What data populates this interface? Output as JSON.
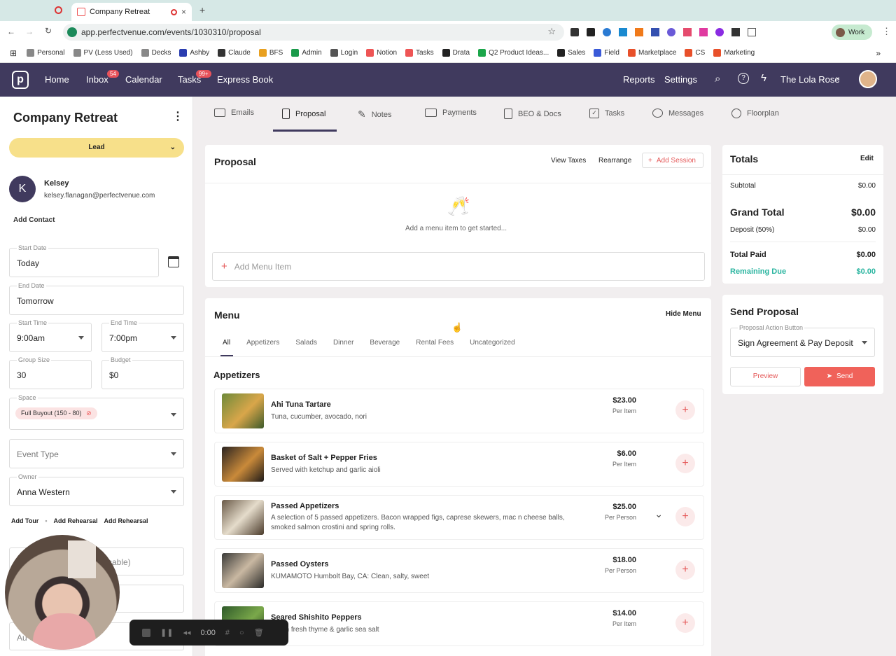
{
  "browser": {
    "tab_title": "Company Retreat",
    "url": "app.perfectvenue.com/events/1030310/proposal",
    "profile": "Work",
    "bookmarks": [
      "Personal",
      "PV (Less Used)",
      "Decks",
      "Ashby",
      "Claude",
      "BFS",
      "Admin",
      "Login",
      "Notion",
      "Tasks",
      "Drata",
      "Q2 Product Ideas...",
      "Sales",
      "Field",
      "Marketplace",
      "CS",
      "Marketing"
    ]
  },
  "nav": {
    "items": [
      "Home",
      "Inbox",
      "Calendar",
      "Tasks",
      "Express Book"
    ],
    "inbox_badge": "54",
    "tasks_badge": "99+",
    "reports": "Reports",
    "settings": "Settings",
    "venue": "The Lola Rose"
  },
  "sidebar": {
    "title": "Company Retreat",
    "status": "Lead",
    "contact_initial": "K",
    "contact_name": "Kelsey",
    "contact_email": "kelsey.flanagan@perfectvenue.com",
    "add_contact": "Add Contact",
    "start_date_label": "Start Date",
    "start_date": "Today",
    "end_date_label": "End Date",
    "end_date": "Tomorrow",
    "start_time_label": "Start Time",
    "start_time": "9:00am",
    "end_time_label": "End Time",
    "end_time": "7:00pm",
    "group_size_label": "Group Size",
    "group_size": "30",
    "budget_label": "Budget",
    "budget": "$0",
    "space_label": "Space",
    "space_chip": "Full Buyout (150 - 80)",
    "event_type_placeholder": "Event Type",
    "owner_label": "Owner",
    "owner": "Anna Western",
    "add_tour": "Add Tour",
    "add_rehearsal_1": "Add Rehearsal",
    "add_rehearsal_2": "Add Rehearsal",
    "partial_field_1": "cable)",
    "partial_field_3": "Au"
  },
  "tabs": [
    "Emails",
    "Proposal",
    "Notes",
    "Payments",
    "BEO & Docs",
    "Tasks",
    "Messages",
    "Floorplan"
  ],
  "proposal": {
    "title": "Proposal",
    "view_taxes": "View Taxes",
    "rearrange": "Rearrange",
    "add_session": "Add Session",
    "empty_text": "Add a menu item to get started...",
    "add_menu_item": "Add Menu Item"
  },
  "menu": {
    "title": "Menu",
    "hide": "Hide Menu",
    "filters": [
      "All",
      "Appetizers",
      "Salads",
      "Dinner",
      "Beverage",
      "Rental Fees",
      "Uncategorized"
    ],
    "section": "Appetizers",
    "items": [
      {
        "name": "Ahi Tuna Tartare",
        "desc": "Tuna, cucumber, avocado, nori",
        "price": "$23.00",
        "unit": "Per Item"
      },
      {
        "name": "Basket of Salt + Pepper Fries",
        "desc": "Served with ketchup and garlic aioli",
        "price": "$6.00",
        "unit": "Per Item"
      },
      {
        "name": "Passed Appetizers",
        "desc": "A selection of 5 passed appetizers. Bacon wrapped figs, caprese skewers, mac n cheese balls, smoked salmon crostini and spring rolls.",
        "price": "$25.00",
        "unit": "Per Person"
      },
      {
        "name": "Passed Oysters",
        "desc": "KUMAMOTO Humbolt Bay, CA: Clean, salty, sweet",
        "price": "$18.00",
        "unit": "Per Person"
      },
      {
        "name": "Seared Shishito Peppers",
        "desc": "d with fresh thyme & garlic sea salt",
        "price": "$14.00",
        "unit": "Per Item"
      }
    ]
  },
  "totals": {
    "title": "Totals",
    "edit": "Edit",
    "subtotal_label": "Subtotal",
    "subtotal": "$0.00",
    "grand_label": "Grand Total",
    "grand": "$0.00",
    "deposit_label": "Deposit (50%)",
    "deposit": "$0.00",
    "paid_label": "Total Paid",
    "paid": "$0.00",
    "remaining_label": "Remaining Due",
    "remaining": "$0.00"
  },
  "send": {
    "title": "Send Proposal",
    "action_label": "Proposal Action Button",
    "action": "Sign Agreement & Pay Deposit",
    "preview": "Preview",
    "send": "Send"
  },
  "recorder": {
    "time": "0:00"
  },
  "colors": {
    "nav": "#403a5e",
    "accent": "#e8525a",
    "teal": "#2bb5a0",
    "lead": "#f7e08a"
  }
}
